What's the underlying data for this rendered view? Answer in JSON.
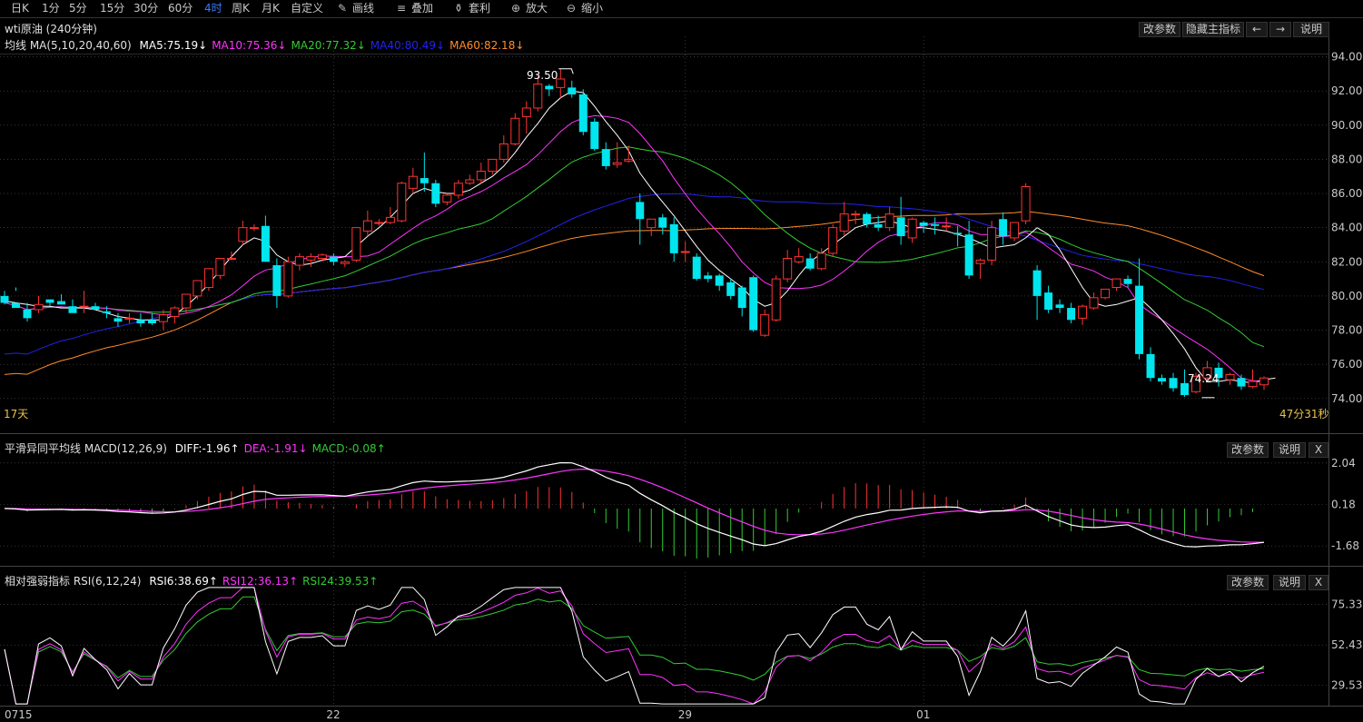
{
  "toolbar": {
    "periods": [
      "日K",
      "1分",
      "5分",
      "15分",
      "30分",
      "60分",
      "4时",
      "周K",
      "月K",
      "自定义"
    ],
    "active_period": "4时",
    "tools": [
      {
        "label": "画线",
        "icon": "pencil-icon"
      },
      {
        "label": "叠加",
        "icon": "stack-icon"
      },
      {
        "label": "套利",
        "icon": "bag-icon"
      },
      {
        "label": "放大",
        "icon": "zoom-in-icon"
      },
      {
        "label": "缩小",
        "icon": "zoom-out-icon"
      }
    ]
  },
  "main": {
    "title": "wti原油 (240分钟)",
    "buttons": {
      "params": "改参数",
      "hide": "隐藏主指标",
      "left": "←",
      "right": "→",
      "help": "说明"
    },
    "ma_label": "均线 MA(5,10,20,40,60)",
    "ma_values": [
      {
        "text": "MA5:75.19↓",
        "color": "#ffffff"
      },
      {
        "text": "MA10:75.36↓",
        "color": "#ff33ff"
      },
      {
        "text": "MA20:77.32↓",
        "color": "#33cc33"
      },
      {
        "text": "MA40:80.49↓",
        "color": "#2222ee"
      },
      {
        "text": "MA60:82.18↓",
        "color": "#ff8c2a"
      }
    ],
    "high_label": "93.50",
    "low_label": "74.24",
    "days_label": "17天",
    "countdown": "47分31秒"
  },
  "macd": {
    "label": "平滑异同平均线 MACD(12,26,9)",
    "values": [
      {
        "text": "DIFF:-1.96↑",
        "color": "#ffffff"
      },
      {
        "text": "DEA:-1.91↓",
        "color": "#ff33ff"
      },
      {
        "text": "MACD:-0.08↑",
        "color": "#33cc33"
      }
    ],
    "buttons": {
      "params": "改参数",
      "help": "说明",
      "close": "X"
    }
  },
  "rsi": {
    "label": "相对强弱指标 RSI(6,12,24)",
    "values": [
      {
        "text": "RSI6:38.69↑",
        "color": "#ffffff"
      },
      {
        "text": "RSI12:36.13↑",
        "color": "#ff33ff"
      },
      {
        "text": "RSI24:39.53↑",
        "color": "#33cc33"
      }
    ],
    "buttons": {
      "params": "改参数",
      "help": "说明",
      "close": "X"
    }
  },
  "colors": {
    "up": "#ff3333",
    "down": "#00e5ee",
    "grid": "#555555",
    "axis_text": "#c8c8c8"
  },
  "chart_data": [
    {
      "type": "candlestick",
      "title": "wti原油 (240分钟)",
      "y_ticks": [
        "94.00",
        "92.00",
        "90.00",
        "88.00",
        "86.00",
        "84.00",
        "82.00",
        "80.00",
        "78.00",
        "76.00",
        "74.00"
      ],
      "ylim": [
        72.5,
        94.4
      ],
      "x_labels": [
        {
          "label": "0715",
          "index": 0
        },
        {
          "label": "22",
          "index": 29
        },
        {
          "label": "29",
          "index": 60
        },
        {
          "label": "01",
          "index": 81
        }
      ],
      "ohlc": [
        [
          80.0,
          80.3,
          79.6,
          79.5
        ],
        [
          79.6,
          80.5,
          79.3,
          80.3
        ],
        [
          79.2,
          79.6,
          78.7,
          78.5
        ],
        [
          79.2,
          80.0,
          79.5,
          79.0
        ],
        [
          79.8,
          79.8,
          79.6,
          79.4
        ],
        [
          79.7,
          80.1,
          79.5,
          79.5
        ],
        [
          79.4,
          79.8,
          79.0,
          79.2
        ],
        [
          79.4,
          80.3,
          79.4,
          79.0
        ],
        [
          79.4,
          79.6,
          79.2,
          79.2
        ],
        [
          79.1,
          79.4,
          79.0,
          78.7
        ],
        [
          78.7,
          79.0,
          78.5,
          78.2
        ],
        [
          78.7,
          79.0,
          78.7,
          78.4
        ],
        [
          78.6,
          79.0,
          78.4,
          78.2
        ],
        [
          78.6,
          79.0,
          78.4,
          78.3
        ],
        [
          78.5,
          79.2,
          78.9,
          78.0
        ],
        [
          78.8,
          79.4,
          79.3,
          78.4
        ],
        [
          79.3,
          80.1,
          80.1,
          79.0
        ],
        [
          80.0,
          80.9,
          80.9,
          79.8
        ],
        [
          80.5,
          81.6,
          81.6,
          80.3
        ],
        [
          81.2,
          82.2,
          82.2,
          81.0
        ],
        [
          82.2,
          82.6,
          82.2,
          82.1
        ],
        [
          83.2,
          84.4,
          84.0,
          83.0
        ],
        [
          84.0,
          84.2,
          84.0,
          83.8
        ],
        [
          84.1,
          84.7,
          82.0,
          82.0
        ],
        [
          81.8,
          82.2,
          80.0,
          79.3
        ],
        [
          80.0,
          82.3,
          82.0,
          79.9
        ],
        [
          81.8,
          82.5,
          82.3,
          81.5
        ],
        [
          82.1,
          82.5,
          82.3,
          81.7
        ],
        [
          82.2,
          82.5,
          82.4,
          82.0
        ],
        [
          82.3,
          82.5,
          82.0,
          81.8
        ],
        [
          81.9,
          82.1,
          82.0,
          81.7
        ],
        [
          82.1,
          84.0,
          84.0,
          82.0
        ],
        [
          83.8,
          85.0,
          84.4,
          83.5
        ],
        [
          84.3,
          84.5,
          84.3,
          84.1
        ],
        [
          84.3,
          85.2,
          84.6,
          84.2
        ],
        [
          84.4,
          86.7,
          86.6,
          84.3
        ],
        [
          86.3,
          87.5,
          87.0,
          86.0
        ],
        [
          86.9,
          88.4,
          86.6,
          86.1
        ],
        [
          86.6,
          86.8,
          85.4,
          85.2
        ],
        [
          85.5,
          86.0,
          85.9,
          85.3
        ],
        [
          85.9,
          86.8,
          86.6,
          85.7
        ],
        [
          86.6,
          87.1,
          86.8,
          86.5
        ],
        [
          86.8,
          87.8,
          87.3,
          86.6
        ],
        [
          87.3,
          88.0,
          88.0,
          87.1
        ],
        [
          88.0,
          89.4,
          88.9,
          87.8
        ],
        [
          88.9,
          90.7,
          90.4,
          88.8
        ],
        [
          90.5,
          91.4,
          91.0,
          89.5
        ],
        [
          91.0,
          92.9,
          92.4,
          90.8
        ],
        [
          92.3,
          92.4,
          92.1,
          91.7
        ],
        [
          92.2,
          93.3,
          92.7,
          91.6
        ],
        [
          92.2,
          92.6,
          91.8,
          91.6
        ],
        [
          91.8,
          92.1,
          89.6,
          89.4
        ],
        [
          90.2,
          90.4,
          88.6,
          88.5
        ],
        [
          88.6,
          89.0,
          87.6,
          87.4
        ],
        [
          87.7,
          89.0,
          87.8,
          87.5
        ],
        [
          87.9,
          88.8,
          88.0,
          87.8
        ],
        [
          85.5,
          86.0,
          84.5,
          83.0
        ],
        [
          84.0,
          84.5,
          84.5,
          83.5
        ],
        [
          84.6,
          84.8,
          84.0,
          83.6
        ],
        [
          84.2,
          84.6,
          82.5,
          82.0
        ],
        [
          82.6,
          83.2,
          82.6,
          82.0
        ],
        [
          82.3,
          82.5,
          81.0,
          80.9
        ],
        [
          81.2,
          81.4,
          81.0,
          80.8
        ],
        [
          81.2,
          81.3,
          80.6,
          80.3
        ],
        [
          80.8,
          81.0,
          80.0,
          79.8
        ],
        [
          80.5,
          80.6,
          79.3,
          78.8
        ],
        [
          81.1,
          81.2,
          78.0,
          77.9
        ],
        [
          77.7,
          79.2,
          78.9,
          77.6
        ],
        [
          78.6,
          81.2,
          81.0,
          78.5
        ],
        [
          81.0,
          82.7,
          82.2,
          80.8
        ],
        [
          82.0,
          82.8,
          82.3,
          81.9
        ],
        [
          82.2,
          82.5,
          81.6,
          81.5
        ],
        [
          81.6,
          82.8,
          82.5,
          81.5
        ],
        [
          82.5,
          84.2,
          84.0,
          82.3
        ],
        [
          83.8,
          85.5,
          84.8,
          83.5
        ],
        [
          84.8,
          85.0,
          84.8,
          84.2
        ],
        [
          84.8,
          84.9,
          84.2,
          84.0
        ],
        [
          84.2,
          84.7,
          84.0,
          83.8
        ],
        [
          84.0,
          85.2,
          84.8,
          83.8
        ],
        [
          84.6,
          85.8,
          83.5,
          83.0
        ],
        [
          83.4,
          84.6,
          84.5,
          83.1
        ],
        [
          84.3,
          84.4,
          84.1,
          83.7
        ],
        [
          84.2,
          84.6,
          84.1,
          83.6
        ],
        [
          84.1,
          84.6,
          84.1,
          83.8
        ],
        [
          83.7,
          84.1,
          83.6,
          82.9
        ],
        [
          83.6,
          84.4,
          81.2,
          81.0
        ],
        [
          81.9,
          82.2,
          82.1,
          81.0
        ],
        [
          82.1,
          84.4,
          84.0,
          81.8
        ],
        [
          84.5,
          84.9,
          83.5,
          83.0
        ],
        [
          83.4,
          84.2,
          84.3,
          83.2
        ],
        [
          84.4,
          86.6,
          86.4,
          84.2
        ],
        [
          81.5,
          81.8,
          80.0,
          78.6
        ],
        [
          80.2,
          80.6,
          79.2,
          79.0
        ],
        [
          79.5,
          79.8,
          79.3,
          79.0
        ],
        [
          79.3,
          79.6,
          78.6,
          78.4
        ],
        [
          78.7,
          79.5,
          79.4,
          78.3
        ],
        [
          79.3,
          80.2,
          79.9,
          79.2
        ],
        [
          79.9,
          80.3,
          80.4,
          79.8
        ],
        [
          80.5,
          81.0,
          81.0,
          80.3
        ],
        [
          81.0,
          81.2,
          80.7,
          80.5
        ],
        [
          80.6,
          82.2,
          76.6,
          76.3
        ],
        [
          76.6,
          77.0,
          75.2,
          75.0
        ],
        [
          75.2,
          75.4,
          75.0,
          74.8
        ],
        [
          75.2,
          75.5,
          74.6,
          74.4
        ],
        [
          74.9,
          75.7,
          74.2,
          74.1
        ],
        [
          74.4,
          75.5,
          75.3,
          74.3
        ],
        [
          75.2,
          76.2,
          75.8,
          75.1
        ],
        [
          75.8,
          76.1,
          75.2,
          74.7
        ],
        [
          75.1,
          75.5,
          75.4,
          74.8
        ],
        [
          75.2,
          75.4,
          74.7,
          74.5
        ],
        [
          74.7,
          75.7,
          75.0,
          74.6
        ],
        [
          74.8,
          75.3,
          75.2,
          74.5
        ]
      ],
      "ma5": [
        79.7,
        79.6,
        79.5,
        79.4,
        79.4,
        79.3,
        79.3,
        79.3,
        79.2,
        79.0,
        78.8,
        78.7,
        78.6,
        78.6,
        78.6,
        78.9,
        79.4,
        80.0,
        80.7,
        81.5,
        82.3,
        83.0,
        83.4,
        83.2,
        82.4,
        82.0,
        81.8,
        81.9,
        82.1,
        82.2,
        82.3,
        82.9,
        83.5,
        84.0,
        84.6,
        85.3,
        86.0,
        86.3,
        86.1,
        86.0,
        86.0,
        86.2,
        86.6,
        87.0,
        87.6,
        88.4,
        89.3,
        90.1,
        91.0,
        91.6,
        92.0,
        91.9,
        91.1,
        90.2,
        89.4,
        88.5,
        87.2,
        86.3,
        85.5,
        84.7,
        83.8,
        82.9,
        82.1,
        81.5,
        81.0,
        80.5,
        79.8,
        79.4,
        79.6,
        80.3,
        81.2,
        82.0,
        82.5,
        83.0,
        83.5,
        84.0,
        84.2,
        84.3,
        84.4,
        84.2,
        84.0,
        84.0,
        83.9,
        83.8,
        83.6,
        83.4,
        83.1,
        82.8,
        82.9,
        83.0,
        83.4,
        84.0,
        83.6,
        82.7,
        81.6,
        80.5,
        79.6,
        79.4,
        79.5,
        79.7,
        79.9,
        79.3,
        78.6,
        77.8,
        76.9,
        75.8,
        75.0,
        75.0,
        75.1,
        75.0,
        74.9,
        75.1,
        75.2
      ]
    },
    {
      "type": "macd",
      "title": "平滑异同平均线 MACD(12,26,9)",
      "y_ticks": [
        "2.04",
        "0.18",
        "-1.68"
      ],
      "ylim": [
        -2.2,
        2.6
      ]
    },
    {
      "type": "rsi",
      "title": "相对强弱指标 RSI(6,12,24)",
      "y_ticks": [
        "75.33",
        "52.43",
        "29.53"
      ],
      "ylim": [
        18,
        86
      ]
    }
  ]
}
